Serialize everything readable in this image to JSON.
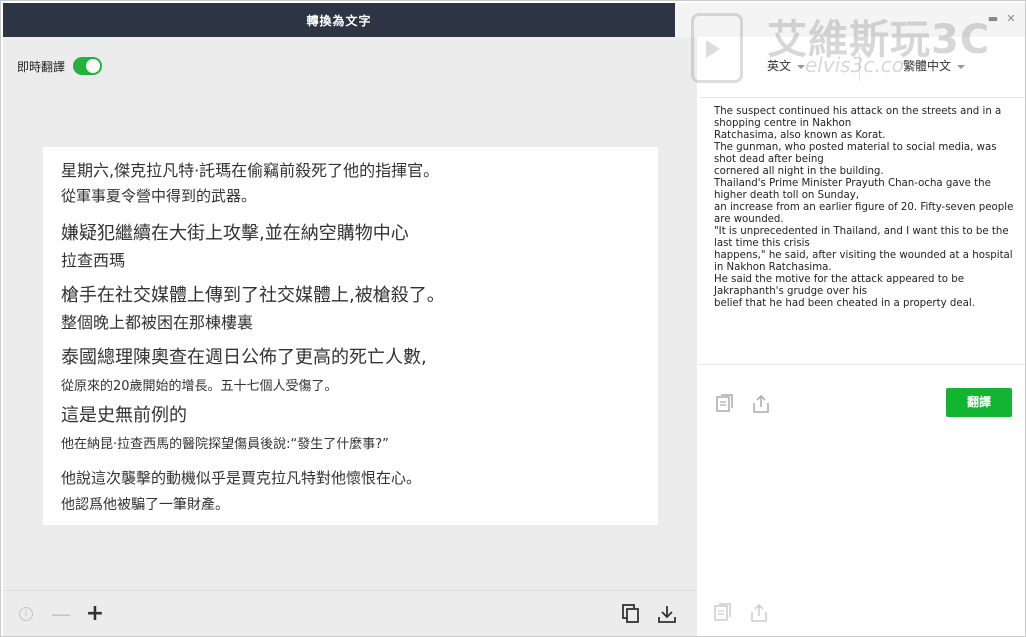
{
  "window": {
    "title": "轉換為文字",
    "watermark_title": "艾維斯玩3C",
    "watermark_url": "elvis3c.com"
  },
  "left": {
    "live_translate_label": "即時翻譯",
    "live_translate_on": true,
    "transcript": [
      {
        "l1": "星期六,傑克拉凡特·託瑪在偷竊前殺死了他的指揮官。",
        "l2": "從軍事夏令營中得到的武器。"
      },
      {
        "l1": "嫌疑犯繼續在大街上攻擊,並在納空購物中心",
        "l2": "拉查西瑪"
      },
      {
        "l1": "槍手在社交媒體上傳到了社交媒體上,被槍殺了。",
        "l2": "整個晚上都被困在那棟樓裏"
      },
      {
        "l1": "泰國總理陳奧查在週日公佈了更高的死亡人數,",
        "l2": "從原來的20歲開始的增長。五十七個人受傷了。"
      },
      {
        "l1": "這是史無前例的",
        "l2": "他在納昆·拉查西馬的醫院探望傷員後說:“發生了什麼事?”"
      },
      {
        "l1": "他說這次襲擊的動機似乎是賈克拉凡特對他懷恨在心。",
        "l2": "他認爲他被騙了一筆財產。"
      }
    ]
  },
  "right": {
    "source_lang": "英文",
    "target_lang": "繁體中文",
    "translate_button": "翻譯",
    "result_lines": [
      "The suspect continued his attack on the streets and in a shopping centre in Nakhon",
      "Ratchasima, also known as Korat.",
      "The gunman, who posted material to social media, was shot dead after being",
      "cornered all night in the building.",
      "Thailand's Prime Minister Prayuth Chan-ocha gave the higher death toll on Sunday,",
      "an increase from an earlier figure of 20. Fifty-seven people are wounded.",
      "\"It is unprecedented in Thailand, and I want this to be the last time this crisis",
      "happens,\" he said, after visiting the wounded at a hospital in Nakhon Ratchasima.",
      "He said the motive for the attack appeared to be Jakraphanth's grudge over his",
      "belief that he had been cheated in a property deal."
    ]
  },
  "colors": {
    "titlebar": "#2d3443",
    "accent_green": "#12b531",
    "pane_bg": "#ececec"
  }
}
